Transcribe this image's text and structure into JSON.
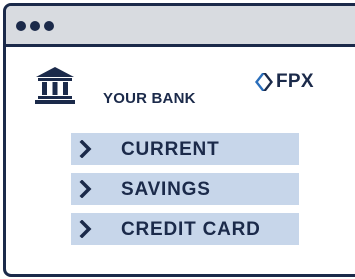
{
  "window": {
    "controls": [
      "dot",
      "dot",
      "dot"
    ]
  },
  "bank": {
    "icon": "bank-building-icon",
    "name": "YOUR BANK"
  },
  "fpx": {
    "icon": "fpx-logo-mark",
    "label": "FPX"
  },
  "accounts": [
    {
      "label": "CURRENT",
      "icon": "chevron-right-icon"
    },
    {
      "label": "SAVINGS",
      "icon": "chevron-right-icon"
    },
    {
      "label": "CREDIT CARD",
      "icon": "chevron-right-icon"
    }
  ],
  "colors": {
    "ink": "#1b2a4a",
    "titlebar": "#d8dbe0",
    "row": "#c7d6ea",
    "fpx_accent": "#2a6ebb"
  }
}
